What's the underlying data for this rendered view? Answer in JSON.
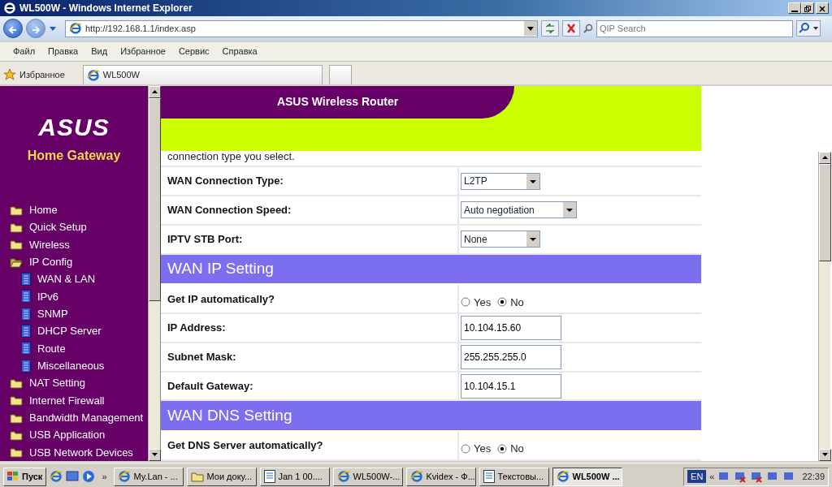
{
  "window": {
    "title": "WL500W - Windows Internet Explorer"
  },
  "address_bar": {
    "url": "http://192.168.1.1/index.asp"
  },
  "search": {
    "placeholder": "QIP Search"
  },
  "menu": [
    "Файл",
    "Правка",
    "Вид",
    "Избранное",
    "Сервис",
    "Справка"
  ],
  "favorites": {
    "label": "Избранное",
    "tab": "WL500W"
  },
  "sidebar": {
    "logo": "ASUS",
    "subtitle": "Home Gateway",
    "items": [
      {
        "label": "Home",
        "kind": "folder"
      },
      {
        "label": "Quick Setup",
        "kind": "folder"
      },
      {
        "label": "Wireless",
        "kind": "folder"
      },
      {
        "label": "IP Config",
        "kind": "folder",
        "expanded": true,
        "children": [
          {
            "label": "WAN & LAN",
            "kind": "page"
          },
          {
            "label": "IPv6",
            "kind": "page"
          },
          {
            "label": "SNMP",
            "kind": "page"
          },
          {
            "label": "DHCP Server",
            "kind": "page"
          },
          {
            "label": "Route",
            "kind": "page"
          },
          {
            "label": "Miscellaneous",
            "kind": "page"
          }
        ]
      },
      {
        "label": "NAT Setting",
        "kind": "folder"
      },
      {
        "label": "Internet Firewall",
        "kind": "folder"
      },
      {
        "label": "Bandwidth Management",
        "kind": "folder"
      },
      {
        "label": "USB Application",
        "kind": "folder"
      },
      {
        "label": "USB Network Devices",
        "kind": "folder"
      }
    ]
  },
  "header": {
    "title": "ASUS Wireless Router"
  },
  "intro_text": "connection type you select.",
  "form_rows": [
    {
      "kind": "select",
      "label": "WAN Connection Type:",
      "value": "L2TP"
    },
    {
      "kind": "select",
      "label": "WAN Connection Speed:",
      "value": "Auto negotiation"
    },
    {
      "kind": "select",
      "label": "IPTV STB Port:",
      "value": "None"
    },
    {
      "kind": "section",
      "label": "WAN IP Setting"
    },
    {
      "kind": "radio",
      "label": "Get IP automatically?",
      "options": [
        {
          "label": "Yes",
          "selected": false
        },
        {
          "label": "No",
          "selected": true
        }
      ]
    },
    {
      "kind": "input",
      "label": "IP Address:",
      "value": "10.104.15.60"
    },
    {
      "kind": "input",
      "label": "Subnet Mask:",
      "value": "255.255.255.0"
    },
    {
      "kind": "input",
      "label": "Default Gateway:",
      "value": "10.104.15.1"
    },
    {
      "kind": "section",
      "label": "WAN DNS Setting"
    },
    {
      "kind": "radio",
      "label": "Get DNS Server automatically?",
      "options": [
        {
          "label": "Yes",
          "selected": false
        },
        {
          "label": "No",
          "selected": true
        }
      ]
    }
  ],
  "taskbar": {
    "start": "Пуск",
    "more": "»",
    "tasks": [
      {
        "label": "My.Lan - ...",
        "kind": "ie",
        "selected": false
      },
      {
        "label": "Мои доку...",
        "kind": "folder",
        "selected": false
      },
      {
        "label": "Jan  1 00....",
        "kind": "doc",
        "selected": false
      },
      {
        "label": "WL500W-...",
        "kind": "ie",
        "selected": false
      },
      {
        "label": "Kvidex - Ф...",
        "kind": "ie",
        "selected": false
      },
      {
        "label": "Текстовы...",
        "kind": "doc",
        "selected": false
      },
      {
        "label": "WL500W ...",
        "kind": "ie",
        "selected": true
      }
    ],
    "language": "EN",
    "tray_toggle": "«",
    "clock": "22:39"
  }
}
